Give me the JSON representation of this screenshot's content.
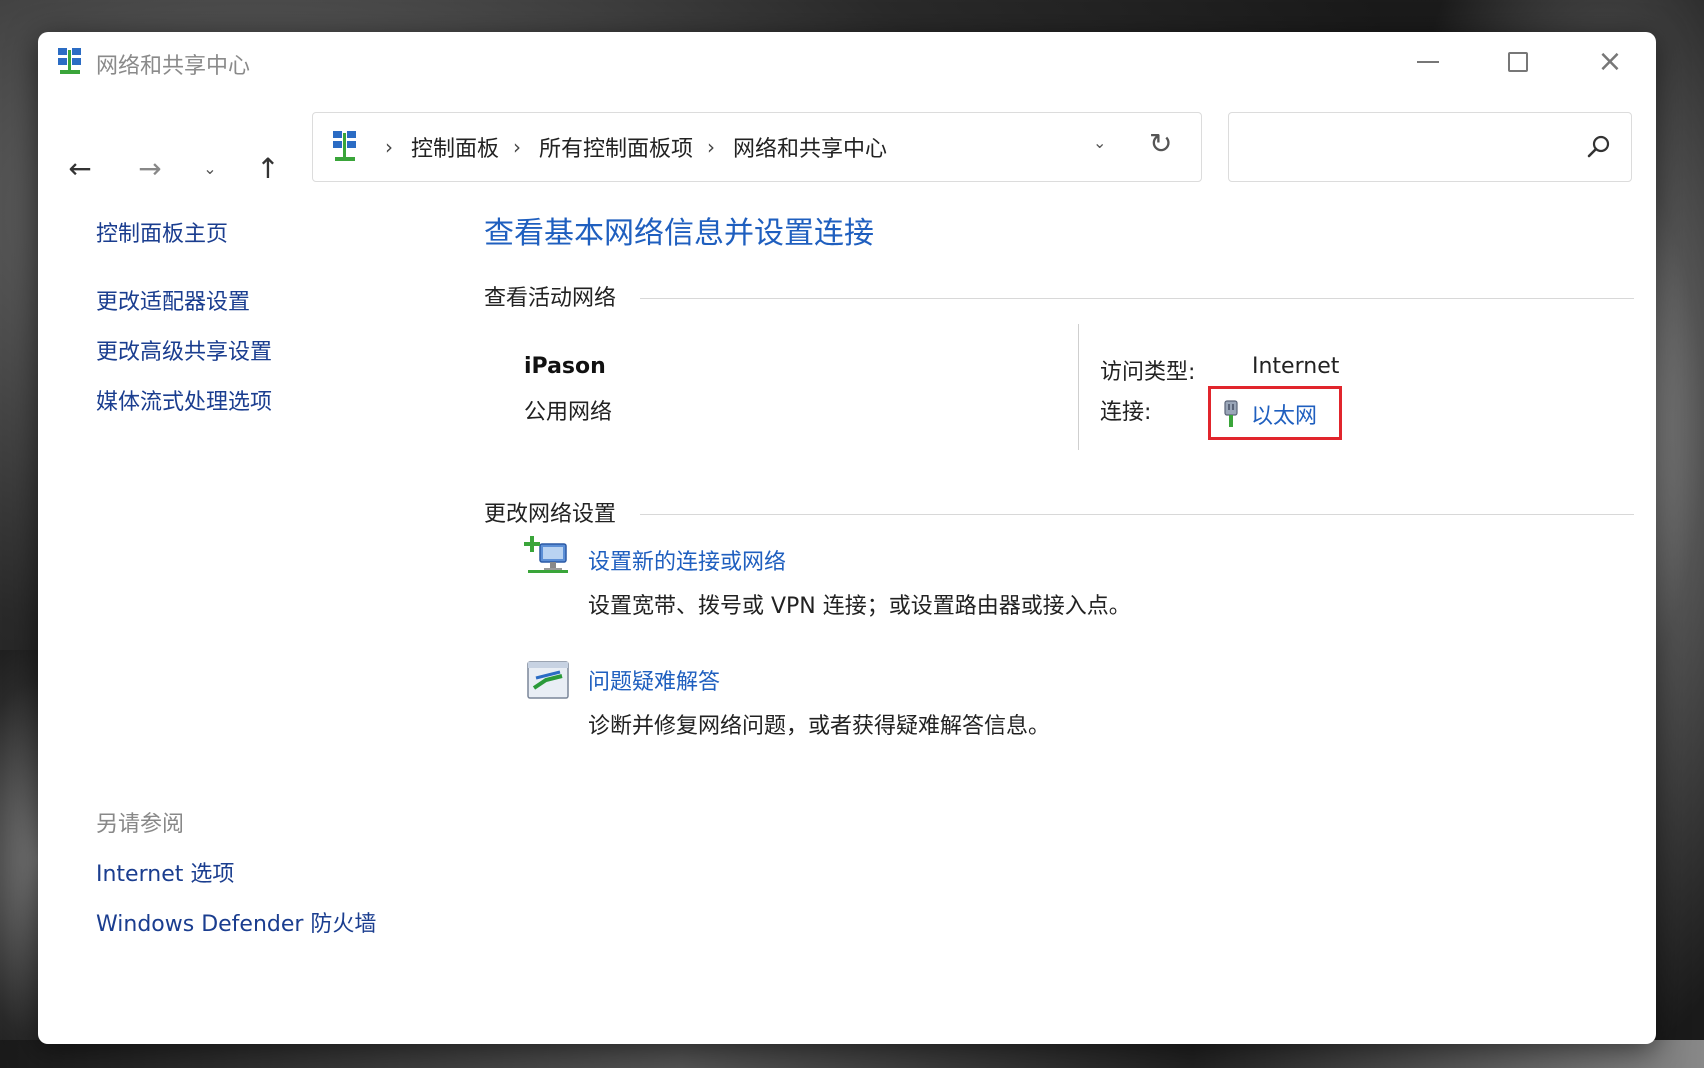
{
  "window": {
    "title": "网络和共享中心"
  },
  "address": {
    "crumbs": [
      "控制面板",
      "所有控制面板项",
      "网络和共享中心"
    ],
    "search_placeholder": ""
  },
  "left_pane": {
    "home": "控制面板主页",
    "links": [
      "更改适配器设置",
      "更改高级共享设置",
      "媒体流式处理选项"
    ],
    "see_also_title": "另请参阅",
    "see_also": [
      "Internet 选项",
      "Windows Defender 防火墙"
    ]
  },
  "main": {
    "title": "查看基本网络信息并设置连接",
    "active_section": "查看活动网络",
    "network_name": "iPason",
    "network_type": "公用网络",
    "access_type_label": "访问类型:",
    "access_type_value": "Internet",
    "connection_label": "连接:",
    "connection_value": "以太网",
    "change_section": "更改网络设置",
    "tasks": [
      {
        "link": "设置新的连接或网络",
        "desc": "设置宽带、拨号或 VPN 连接；或设置路由器或接入点。",
        "icon": "new-connection-icon"
      },
      {
        "link": "问题疑难解答",
        "desc": "诊断并修复网络问题，或者获得疑难解答信息。",
        "icon": "troubleshoot-icon"
      }
    ]
  },
  "colors": {
    "link": "#1f5fbf",
    "highlight": "#e1252c"
  }
}
